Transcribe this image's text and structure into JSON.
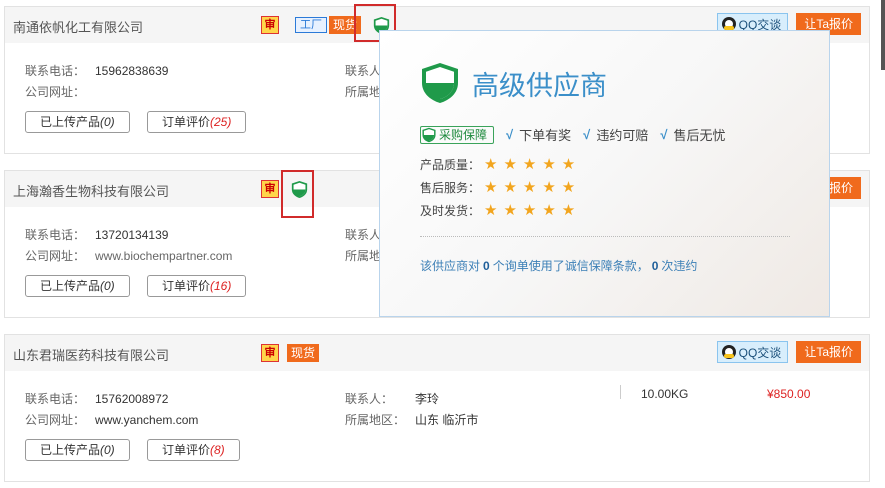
{
  "buttons": {
    "qq": "QQ交谈",
    "quote": "让Ta报价",
    "uploaded_label": "已上传产品",
    "review_label": "订单评价"
  },
  "labels": {
    "phone": "联系电话：",
    "website": "公司网址：",
    "contact": "联系人：",
    "region": "所属地区：",
    "contact_short": "联系人",
    "region_short": "所属地"
  },
  "badges": {
    "shen": "审",
    "factory": "工厂",
    "stock": "现货"
  },
  "suppliers": [
    {
      "name": "南通依帆化工有限公司",
      "phone": "15962838639",
      "website": "",
      "uploaded": "(0)",
      "reviews": "(25)"
    },
    {
      "name": "上海瀚香生物科技有限公司",
      "phone": "13720134139",
      "website": "www.biochempartner.com",
      "uploaded": "(0)",
      "reviews": "(16)"
    },
    {
      "name": "山东君瑞医药科技有限公司",
      "phone": "15762008972",
      "website": "www.yanchem.com",
      "contact": "李玲",
      "region": "山东 临沂市",
      "quantity": "10.00KG",
      "price": "¥850.00",
      "uploaded": "(0)",
      "reviews": "(8)"
    }
  ],
  "popup": {
    "title": "高级供应商",
    "guarantee": "采购保障",
    "features": [
      "下单有奖",
      "违约可赔",
      "售后无忧"
    ],
    "ratings": [
      {
        "label": "产品质量：",
        "stars": 5
      },
      {
        "label": "售后服务：",
        "stars": 5
      },
      {
        "label": "及时发货：",
        "stars": 5
      }
    ],
    "footer_prefix": "该供应商对",
    "footer_count1": "0",
    "footer_middle": "个询单使用了诚信保障条款，",
    "footer_count2": "0",
    "footer_suffix": "次违约"
  },
  "colors": {
    "accent": "#f06a1c",
    "link": "#3b8fc9",
    "shield": "#1f9a4a",
    "highlight": "#d12b2b"
  }
}
